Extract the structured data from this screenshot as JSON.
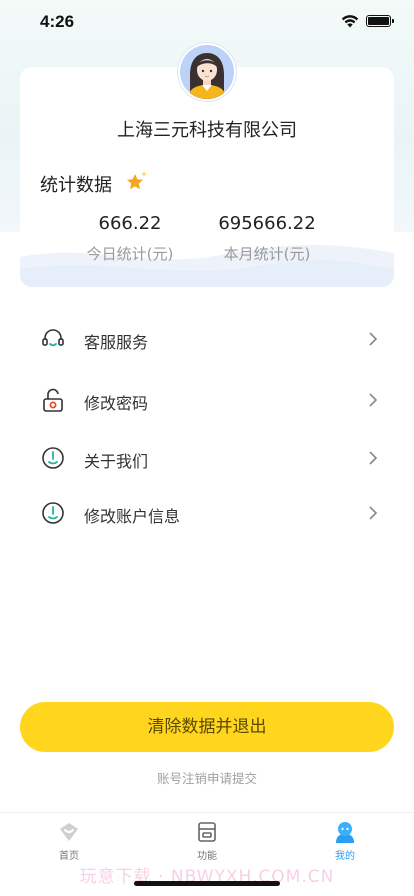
{
  "status_bar": {
    "time": "4:26"
  },
  "profile": {
    "company_name": "上海三元科技有限公司"
  },
  "stats": {
    "title": "统计数据",
    "today_value": "666.22",
    "today_label": "今日统计(元)",
    "month_value": "695666.22",
    "month_label": "本月统计(元)"
  },
  "menu": [
    {
      "label": "客服服务",
      "icon": "headset-icon"
    },
    {
      "label": "修改密码",
      "icon": "lock-icon"
    },
    {
      "label": "关于我们",
      "icon": "info-circle-icon"
    },
    {
      "label": "修改账户信息",
      "icon": "info-circle-icon"
    }
  ],
  "actions": {
    "logout_label": "清除数据并退出",
    "deregister_label": "账号注销申请提交"
  },
  "tabs": [
    {
      "label": "首页",
      "icon": "home-icon",
      "active": false
    },
    {
      "label": "功能",
      "icon": "store-icon",
      "active": false
    },
    {
      "label": "我的",
      "icon": "profile-icon",
      "active": true
    }
  ],
  "watermark": "玩意下载 · NBWYXH.COM.CN",
  "colors": {
    "accent_yellow": "#ffd51e",
    "tab_active_blue": "#2a9df4",
    "icon_teal": "#25b3a6",
    "icon_red": "#e84b3c"
  }
}
